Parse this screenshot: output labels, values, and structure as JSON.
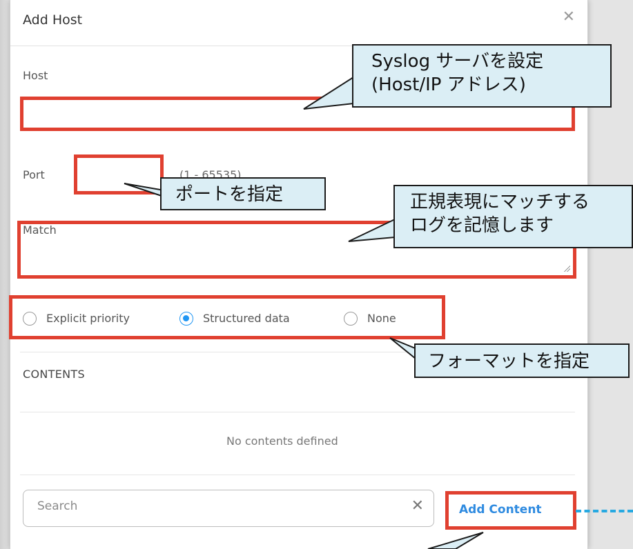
{
  "dialog": {
    "title": "Add Host",
    "close_icon": "close-icon"
  },
  "fields": {
    "host_label": "Host",
    "host_value": "",
    "port_label": "Port",
    "port_value": "",
    "port_range": "(1 - 65535)",
    "match_label": "Match",
    "match_value": ""
  },
  "format_options": [
    {
      "label": "Explicit priority",
      "checked": false
    },
    {
      "label": "Structured data",
      "checked": true
    },
    {
      "label": "None",
      "checked": false
    }
  ],
  "contents": {
    "section_title": "CONTENTS",
    "empty_message": "No contents defined",
    "search_placeholder": "Search",
    "clear_icon": "close-icon",
    "add_button": "Add Content"
  },
  "annotations": {
    "host_note_line1": "Syslog サーバを設定",
    "host_note_line2": "(Host/IP アドレス)",
    "port_note": "ポートを指定",
    "match_note_line1": "正規表現にマッチする",
    "match_note_line2": "ログを記憶します",
    "format_note": "フォーマットを指定"
  },
  "colors": {
    "highlight_red": "#e04030",
    "callout_fill": "#dbeef5",
    "accent_blue": "#2f8be0",
    "radio_blue": "#2196f3",
    "dash_blue": "#27a9e1"
  }
}
